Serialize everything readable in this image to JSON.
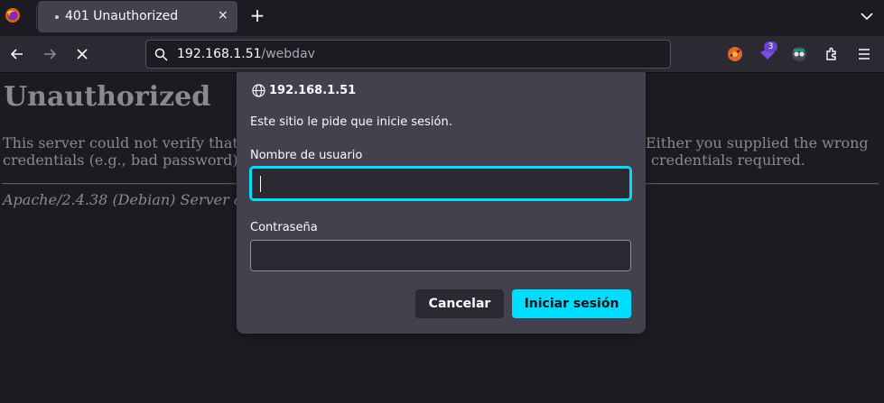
{
  "tabs": [
    {
      "title": "401 Unauthorized",
      "close_glyph": "×"
    }
  ],
  "tabstrip": {
    "new_tab_glyph": "+"
  },
  "urlbar": {
    "host": "192.168.1.51",
    "path": "/webdav"
  },
  "extensions": {
    "badge_count": "3"
  },
  "page": {
    "heading": "Unauthorized",
    "line1_left": "This server could not verify that",
    "line1_right": "Either you supplied the wrong",
    "line2_left": "credentials (e.g., bad password)",
    "line2_right": "credentials required.",
    "address": "Apache/2.4.38 (Debian) Server a"
  },
  "dialog": {
    "host": "192.168.1.51",
    "message": "Este sitio le pide que inicie sesión.",
    "username_label": "Nombre de usuario",
    "username_value": "",
    "password_label": "Contraseña",
    "password_value": "",
    "cancel_label": "Cancelar",
    "login_label": "Iniciar sesión"
  },
  "colors": {
    "accent": "#00ddff",
    "dialog_bg": "#42414d",
    "toolbar_bg": "#2b2a33",
    "frame_bg": "#1c1b22"
  }
}
